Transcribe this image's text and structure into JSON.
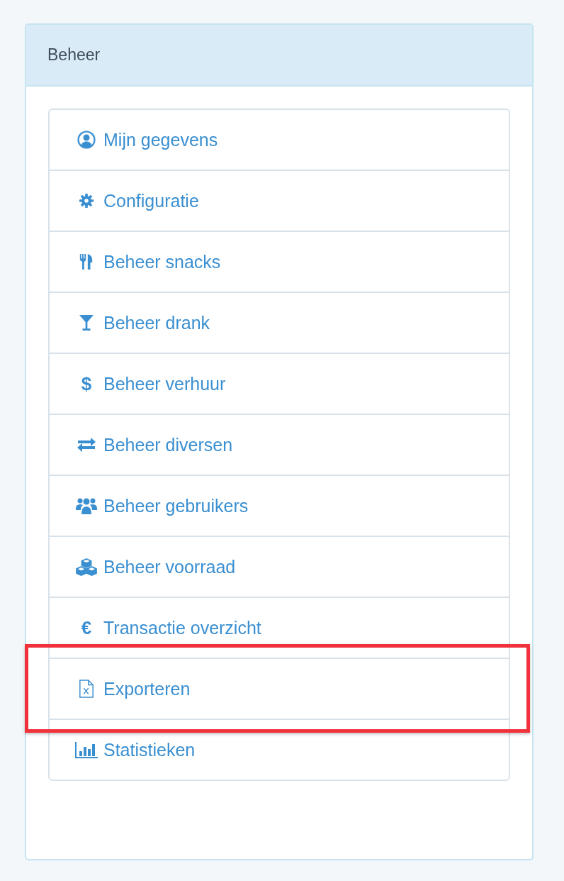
{
  "panel": {
    "title": "Beheer"
  },
  "items": [
    {
      "label": "Mijn gegevens",
      "kind": "user",
      "highlighted": false
    },
    {
      "label": "Configuratie",
      "kind": "gear",
      "highlighted": false
    },
    {
      "label": "Beheer snacks",
      "kind": "cutlery",
      "highlighted": false
    },
    {
      "label": "Beheer drank",
      "kind": "glass",
      "highlighted": false
    },
    {
      "label": "Beheer verhuur",
      "kind": "glyph",
      "glyph": "$",
      "highlighted": false
    },
    {
      "label": "Beheer diversen",
      "kind": "exchange",
      "highlighted": false
    },
    {
      "label": "Beheer gebruikers",
      "kind": "users",
      "highlighted": false
    },
    {
      "label": "Beheer voorraad",
      "kind": "cubes",
      "highlighted": false
    },
    {
      "label": "Transactie overzicht",
      "kind": "glyph",
      "glyph": "€",
      "highlighted": false
    },
    {
      "label": "Exporteren",
      "kind": "file",
      "highlighted": true
    },
    {
      "label": "Statistieken",
      "kind": "chart",
      "highlighted": false
    }
  ]
}
